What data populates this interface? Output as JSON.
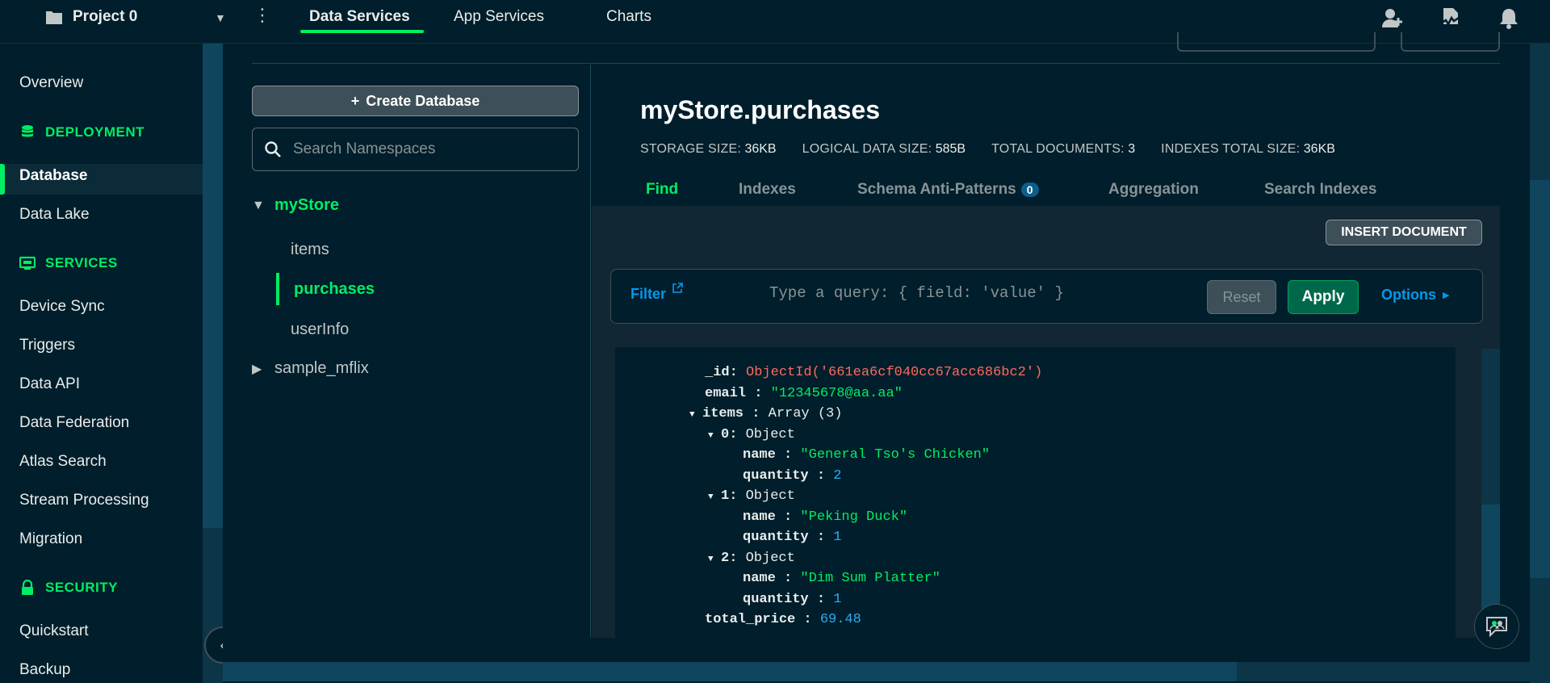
{
  "topbar": {
    "project_name": "Project 0",
    "tabs": [
      "Data Services",
      "App Services",
      "Charts"
    ],
    "icons": [
      "add-user-icon",
      "activity-icon",
      "bell-icon"
    ]
  },
  "leftnav": {
    "overview": "Overview",
    "deployment_header": "DEPLOYMENT",
    "database": "Database",
    "data_lake": "Data Lake",
    "services_header": "SERVICES",
    "device_sync": "Device Sync",
    "triggers": "Triggers",
    "data_api": "Data API",
    "data_federation": "Data Federation",
    "atlas_search": "Atlas Search",
    "stream_processing": "Stream Processing",
    "migration": "Migration",
    "security_header": "SECURITY",
    "quickstart": "Quickstart",
    "backup": "Backup"
  },
  "namespaces": {
    "create_db_label": "Create Database",
    "search_placeholder": "Search Namespaces",
    "db1": "myStore",
    "collections": [
      "items",
      "purchases",
      "userInfo"
    ],
    "db2": "sample_mflix"
  },
  "collection": {
    "title": "myStore.purchases",
    "stats": {
      "storage_label": "STORAGE SIZE:",
      "storage_value": "36KB",
      "logical_label": "LOGICAL DATA SIZE:",
      "logical_value": "585B",
      "docs_label": "TOTAL DOCUMENTS:",
      "docs_value": "3",
      "indexes_label": "INDEXES TOTAL SIZE:",
      "indexes_value": "36KB"
    },
    "tabs": {
      "find": "Find",
      "indexes": "Indexes",
      "schema": "Schema Anti-Patterns",
      "schema_badge": "0",
      "aggregation": "Aggregation",
      "search_indexes": "Search Indexes"
    },
    "insert_document": "INSERT DOCUMENT"
  },
  "filter": {
    "label": "Filter",
    "placeholder": "Type a query: { field: 'value' }",
    "reset": "Reset",
    "apply": "Apply",
    "options": "Options"
  },
  "document": {
    "id_key": "_id",
    "id_value": "ObjectId('661ea6cf040cc67acc686bc2')",
    "email_key": "email",
    "email_value": "\"12345678@aa.aa\"",
    "items_key": "items",
    "items_type": "Array (3)",
    "object_type": "Object",
    "item0_index": "0:",
    "item1_index": "1:",
    "item2_index": "2:",
    "name_key": "name",
    "quantity_key": "quantity",
    "item0_name": "\"General Tso's Chicken\"",
    "item0_qty": "2",
    "item1_name": "\"Peking Duck\"",
    "item1_qty": "1",
    "item2_name": "\"Dim Sum Platter\"",
    "item2_qty": "1",
    "total_key": "total_price",
    "total_value": "69.48"
  },
  "colors": {
    "accent_green": "#00ed64",
    "link_blue": "#0498ec",
    "background": "#001e2b"
  }
}
